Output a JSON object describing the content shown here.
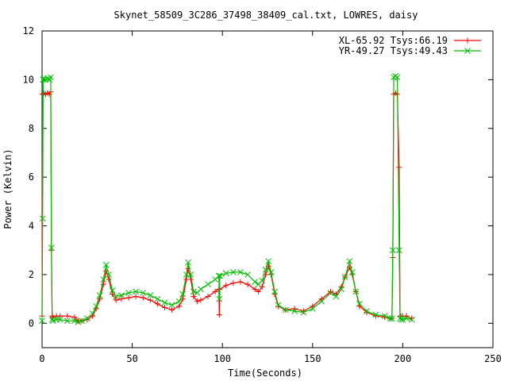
{
  "chart_data": {
    "type": "line",
    "title": "Skynet_58509_3C286_37498_38409_cal.txt, LOWRES, daisy",
    "xlabel": "Time(Seconds)",
    "ylabel": "Power (Kelvin)",
    "xlim": [
      0,
      250
    ],
    "ylim": [
      -1,
      12
    ],
    "xticks": [
      0,
      50,
      100,
      150,
      200,
      250
    ],
    "yticks": [
      0,
      2,
      4,
      6,
      8,
      10,
      12
    ],
    "grid": false,
    "legend_position": "top-right",
    "series": [
      {
        "name": "XL-65.92 Tsys:66.19",
        "color": "#ff0000",
        "marker": "plus",
        "x": [
          0,
          0.3,
          0.6,
          1,
          2,
          3,
          4,
          4.8,
          5.2,
          5.6,
          6,
          8,
          10,
          14,
          18,
          20,
          22,
          25,
          28,
          30,
          32,
          34,
          35.5,
          37,
          39,
          41,
          44,
          48,
          52,
          56,
          60,
          64,
          68,
          72,
          76,
          78,
          80,
          81,
          82.5,
          84,
          86,
          88,
          92,
          96,
          98,
          98.3,
          98.6,
          102,
          106,
          110,
          114,
          118,
          120,
          122,
          124,
          125.5,
          127,
          129,
          131,
          135,
          140,
          145,
          150,
          155,
          160,
          163,
          166,
          168,
          170.5,
          172,
          174,
          176,
          180,
          185,
          190,
          193,
          194,
          194.5,
          195,
          196,
          197,
          198,
          198.5,
          199,
          200,
          202,
          205
        ],
        "y": [
          0.3,
          9.4,
          9.4,
          9.45,
          9.4,
          9.45,
          9.4,
          9.5,
          3.0,
          0.3,
          0.25,
          0.3,
          0.3,
          0.3,
          0.25,
          0.1,
          0.1,
          0.15,
          0.3,
          0.6,
          1.0,
          1.6,
          2.15,
          1.8,
          1.2,
          0.95,
          1.0,
          1.05,
          1.1,
          1.05,
          0.95,
          0.8,
          0.65,
          0.55,
          0.7,
          1.0,
          1.8,
          2.25,
          1.8,
          1.1,
          0.9,
          0.95,
          1.1,
          1.3,
          1.4,
          0.35,
          1.4,
          1.55,
          1.65,
          1.7,
          1.6,
          1.4,
          1.3,
          1.5,
          2.0,
          2.35,
          2.0,
          1.2,
          0.7,
          0.55,
          0.6,
          0.5,
          0.7,
          1.0,
          1.3,
          1.2,
          1.5,
          1.9,
          2.3,
          2.0,
          1.3,
          0.7,
          0.45,
          0.3,
          0.25,
          0.2,
          0.2,
          2.7,
          9.4,
          9.45,
          9.4,
          6.4,
          0.3,
          0.3,
          0.3,
          0.3,
          0.2
        ]
      },
      {
        "name": "YR-49.27 Tsys:49.43",
        "color": "#00c000",
        "marker": "cross",
        "x": [
          0,
          0.3,
          0.6,
          1,
          2,
          3,
          4,
          4.8,
          5.2,
          5.6,
          6,
          8,
          10,
          14,
          18,
          20,
          22,
          25,
          28,
          30,
          32,
          34,
          35.5,
          37,
          39,
          41,
          44,
          48,
          52,
          56,
          60,
          64,
          68,
          72,
          76,
          78,
          80,
          81,
          82.5,
          84,
          86,
          88,
          92,
          96,
          98,
          98.3,
          98.6,
          102,
          106,
          110,
          114,
          118,
          120,
          122,
          124,
          125.5,
          127,
          129,
          131,
          135,
          140,
          145,
          150,
          155,
          160,
          163,
          166,
          168,
          170.5,
          172,
          174,
          176,
          180,
          185,
          190,
          193,
          194,
          194.5,
          195,
          196,
          197,
          198,
          198.5,
          199,
          200,
          202,
          205
        ],
        "y": [
          0.1,
          4.3,
          10.0,
          10.05,
          10.0,
          10.05,
          10.0,
          10.1,
          3.1,
          0.15,
          0.1,
          0.15,
          0.15,
          0.1,
          0.1,
          0.05,
          0.1,
          0.2,
          0.4,
          0.7,
          1.15,
          1.8,
          2.4,
          2.0,
          1.35,
          1.1,
          1.15,
          1.25,
          1.3,
          1.25,
          1.15,
          1.0,
          0.85,
          0.75,
          0.9,
          1.2,
          2.0,
          2.5,
          2.0,
          1.3,
          1.25,
          1.4,
          1.6,
          1.8,
          1.95,
          1.0,
          1.95,
          2.05,
          2.1,
          2.1,
          2.0,
          1.7,
          1.6,
          1.75,
          2.2,
          2.55,
          2.1,
          1.3,
          0.75,
          0.55,
          0.5,
          0.45,
          0.6,
          0.9,
          1.25,
          1.1,
          1.4,
          1.9,
          2.55,
          2.1,
          1.3,
          0.8,
          0.5,
          0.35,
          0.3,
          0.2,
          0.2,
          3.0,
          10.1,
          10.15,
          10.1,
          3.0,
          0.2,
          0.15,
          0.15,
          0.2,
          0.15
        ]
      }
    ]
  }
}
